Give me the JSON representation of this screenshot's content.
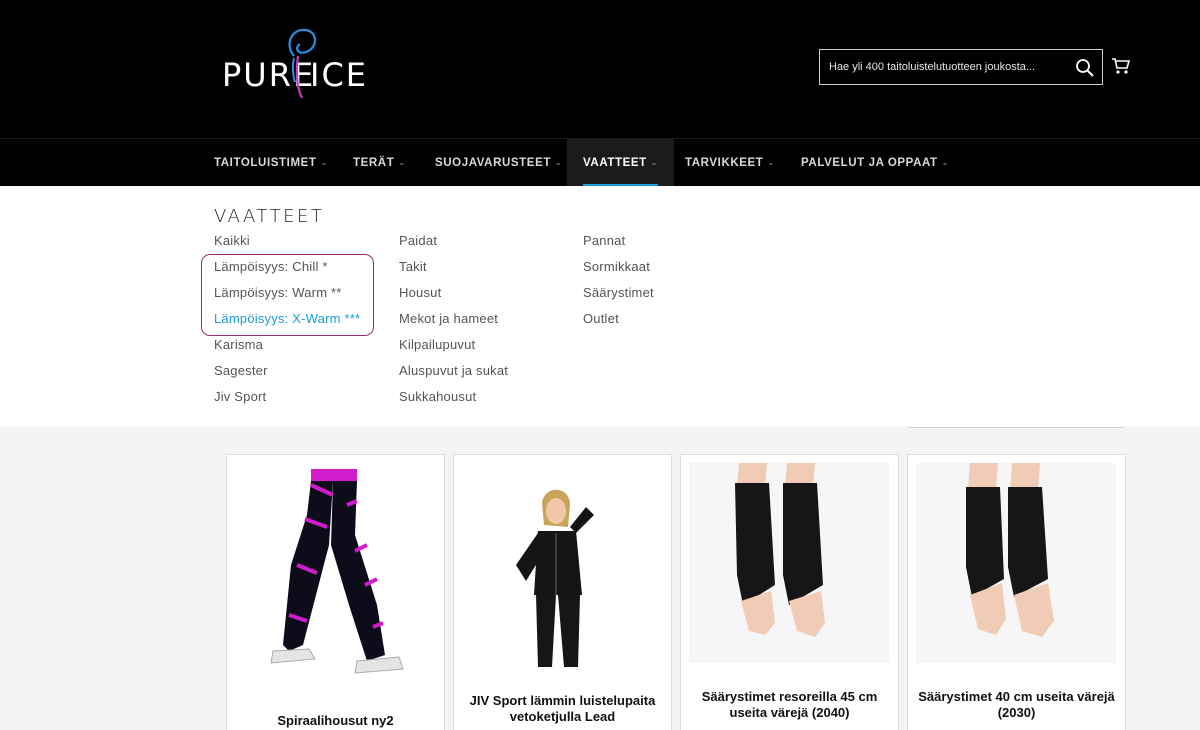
{
  "header": {
    "logo": {
      "left": "PURE",
      "right": "ICE"
    },
    "search": {
      "placeholder": "Hae yli 400 taitoluistelutuotteen joukosta..."
    }
  },
  "nav": {
    "items": [
      {
        "label": "TAITOLUISTIMET"
      },
      {
        "label": "TERÄT"
      },
      {
        "label": "SUOJAVARUSTEET"
      },
      {
        "label": "VAATTEET"
      },
      {
        "label": "TARVIKKEET"
      },
      {
        "label": "PALVELUT JA OPPAAT"
      }
    ],
    "caret": "⌄"
  },
  "mega": {
    "title": "VAATTEET",
    "col1": [
      "Kaikki",
      "Lämpöisyys: Chill *",
      "Lämpöisyys: Warm **",
      "Lämpöisyys: X-Warm ***",
      "Karisma",
      "Sagester",
      "Jiv Sport"
    ],
    "col2": [
      "Paidat",
      "Takit",
      "Housut",
      "Mekot ja hameet",
      "Kilpailupuvut",
      "Aluspuvut ja sukat",
      "Sukkahousut"
    ],
    "col3": [
      "Pannat",
      "Sormikkaat",
      "Säärystimet",
      "Outlet"
    ]
  },
  "products": [
    {
      "title": "Spiraalihousut ny2"
    },
    {
      "title": "JIV Sport lämmin luistelupaita vetoketjulla Lead"
    },
    {
      "title": "Säärystimet resoreilla 45 cm useita värejä (2040)"
    },
    {
      "title": "Säärystimet 40 cm useita värejä (2030)"
    }
  ],
  "colors": {
    "accent": "#1aa0e0",
    "highlight": "#9b2b6f",
    "pink": "#d21ccc"
  },
  "icons": [
    "search-icon",
    "cart-icon"
  ]
}
